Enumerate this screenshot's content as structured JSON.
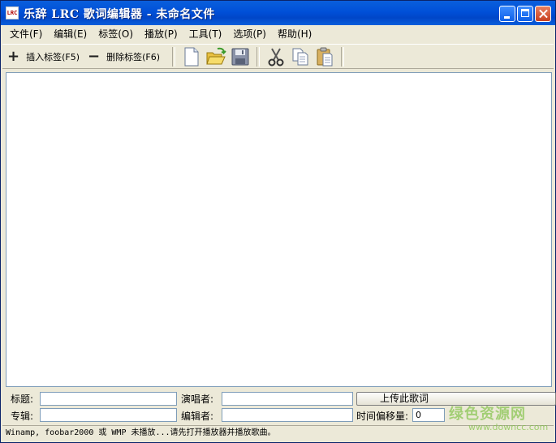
{
  "window": {
    "title": "乐辞 LRC 歌词编辑器 - 未命名文件",
    "icon_text": "LRC"
  },
  "menu": [
    "文件(F)",
    "编辑(E)",
    "标签(O)",
    "播放(P)",
    "工具(T)",
    "选项(P)",
    "帮助(H)"
  ],
  "toolbar": {
    "insert_tag": "插入标签(F5)",
    "delete_tag": "删除标签(F6)",
    "icons": [
      "new-file-icon",
      "open-folder-icon",
      "save-icon",
      "cut-icon",
      "copy-icon",
      "paste-icon"
    ]
  },
  "fields": {
    "title_label": "标题:",
    "title_value": "",
    "artist_label": "演唱者:",
    "artist_value": "",
    "album_label": "专辑:",
    "album_value": "",
    "editor_label": "编辑者:",
    "editor_value": "",
    "offset_label": "时间偏移量:",
    "offset_value": "0"
  },
  "upload_button": "上传此歌词",
  "status": "Winamp, foobar2000 或 WMP 未播放...请先打开播放器并播放歌曲。",
  "watermark": {
    "title": "绿色资源网",
    "url": "www.downcc.com"
  },
  "colors": {
    "titlebar": "#0050d8",
    "window_bg": "#ece9d8",
    "watermark": "#7cc040"
  }
}
